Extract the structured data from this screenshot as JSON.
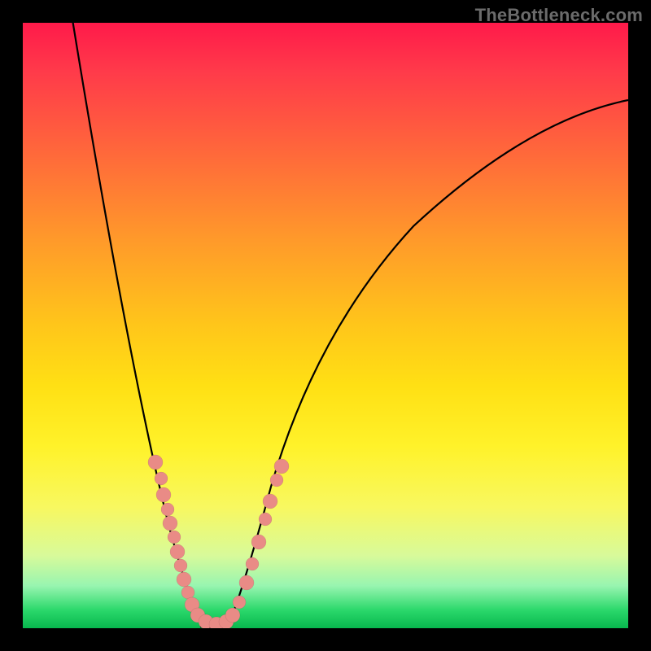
{
  "watermark": "TheBottleneck.com",
  "chart_data": {
    "type": "line",
    "title": "",
    "xlabel": "",
    "ylabel": "",
    "xlim": [
      0,
      100
    ],
    "ylim": [
      0,
      100
    ],
    "background_gradient": [
      "#ff1a4a",
      "#ff9a2a",
      "#fff22a",
      "#08b84e"
    ],
    "series": [
      {
        "name": "bottleneck-curve",
        "color": "#000000",
        "x": [
          8,
          14,
          20,
          26,
          29,
          31,
          33,
          35,
          40,
          48,
          60,
          75,
          90,
          100
        ],
        "y": [
          100,
          65,
          35,
          14,
          5,
          1,
          0.5,
          1,
          8,
          28,
          52,
          72,
          84,
          88
        ]
      },
      {
        "name": "highlighted-points",
        "color": "#e98b86",
        "x": [
          22,
          23,
          23.5,
          24,
          24.5,
          25,
          25.5,
          26,
          26.5,
          27,
          28,
          29,
          30.5,
          32,
          33.5,
          34.5,
          35.5,
          37,
          38.5,
          39.5,
          40.5,
          41.5,
          42.5,
          43
        ],
        "y": [
          27,
          24.5,
          22,
          20,
          17.5,
          15.5,
          13,
          11,
          9,
          6.5,
          4,
          2,
          1,
          0.5,
          1,
          2,
          4,
          7.5,
          10.5,
          14,
          18,
          21,
          24,
          27
        ]
      }
    ],
    "grid": false,
    "legend": false
  }
}
